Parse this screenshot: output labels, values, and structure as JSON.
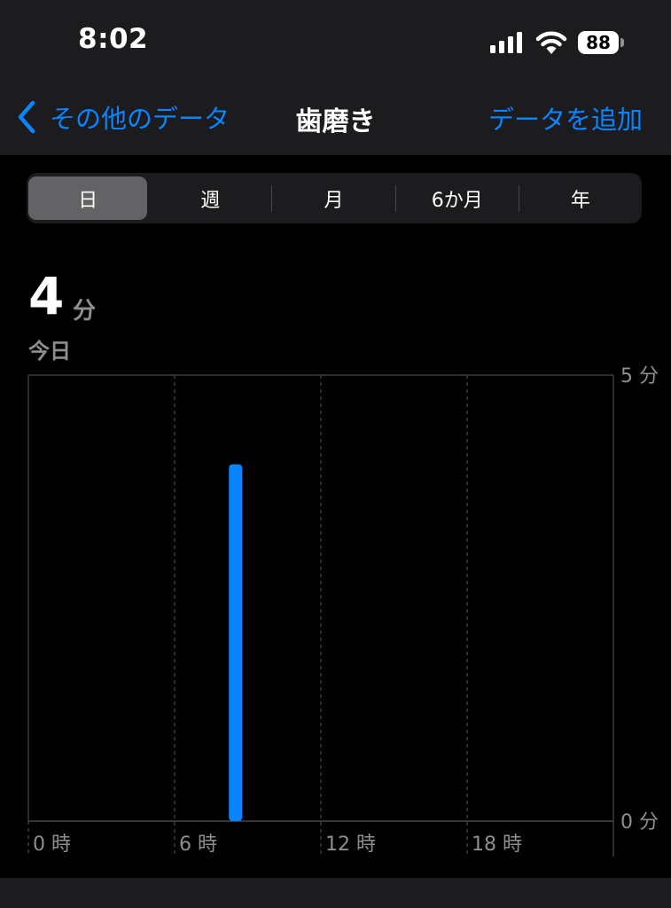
{
  "status_bar": {
    "time": "8:02",
    "battery": "88",
    "signal_icon": "cellular-signal-icon",
    "wifi_icon": "wifi-icon"
  },
  "nav": {
    "back_label": "その他のデータ",
    "title": "歯磨き",
    "add_label": "データを追加",
    "accent_color": "#0a84ff"
  },
  "segments": {
    "items": [
      "日",
      "週",
      "月",
      "6か月",
      "年"
    ],
    "selected": "日"
  },
  "summary": {
    "value": "4",
    "unit": "分",
    "date_label": "今日"
  },
  "chart_data": {
    "type": "bar",
    "x_unit": "hour",
    "xlim": [
      0,
      24
    ],
    "ylim": [
      0,
      5
    ],
    "y_unit": "分",
    "y_ticks": [
      "5 分",
      "0 分"
    ],
    "x_ticks": [
      "0 時",
      "6 時",
      "12 時",
      "18 時"
    ],
    "x_tick_values": [
      0,
      6,
      12,
      18
    ],
    "grid": true,
    "bar_color": "#0a84ff",
    "points": [
      {
        "x": 8.5,
        "y": 4
      }
    ]
  }
}
